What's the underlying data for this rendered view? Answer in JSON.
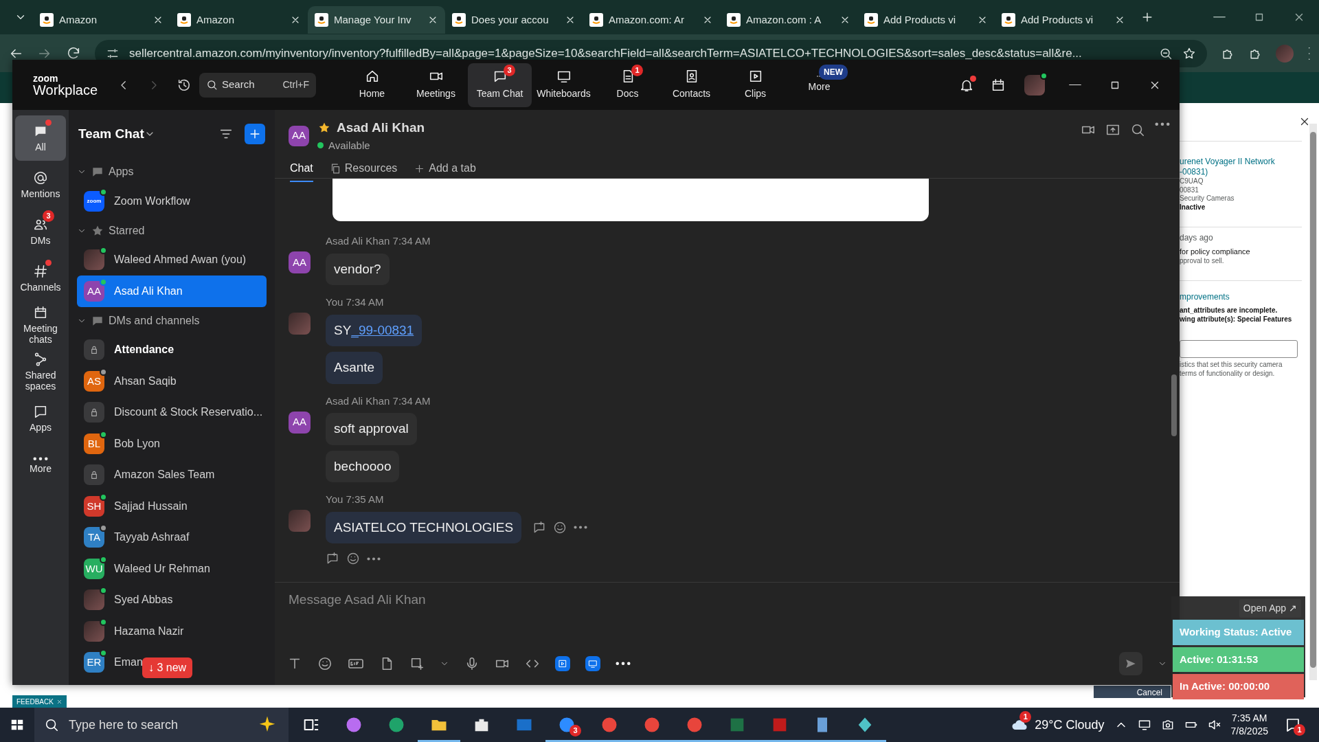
{
  "browser": {
    "tabs": [
      {
        "title": "Amazon",
        "selected": false
      },
      {
        "title": "Amazon",
        "selected": false
      },
      {
        "title": "Manage Your Inv",
        "selected": true
      },
      {
        "title": "Does your accou",
        "selected": false
      },
      {
        "title": "Amazon.com: Ar",
        "selected": false
      },
      {
        "title": "Amazon.com : A",
        "selected": false
      },
      {
        "title": "Add Products vi",
        "selected": false
      },
      {
        "title": "Add Products vi",
        "selected": false
      }
    ],
    "url": "sellercentral.amazon.com/myinventory/inventory?fulfilledBy=all&page=1&pageSize=10&searchField=all&searchTerm=ASIATELCO+TECHNOLOGIES&sort=sales_desc&status=all&re..."
  },
  "zoom": {
    "logo": {
      "top": "zoom",
      "bottom": "Workplace"
    },
    "search": {
      "placeholder": "Search",
      "shortcut": "Ctrl+F"
    },
    "nav": [
      {
        "label": "Home",
        "selected": false
      },
      {
        "label": "Meetings",
        "selected": false
      },
      {
        "label": "Team Chat",
        "selected": true,
        "badge": "3"
      },
      {
        "label": "Whiteboards",
        "selected": false
      },
      {
        "label": "Docs",
        "selected": false,
        "badge": "1"
      },
      {
        "label": "Contacts",
        "selected": false
      },
      {
        "label": "Clips",
        "selected": false
      },
      {
        "label": "More",
        "selected": false,
        "tag": "NEW"
      }
    ],
    "rail": [
      {
        "label": "All",
        "selected": true,
        "dot": true
      },
      {
        "label": "Mentions",
        "selected": false,
        "dot": false
      },
      {
        "label": "DMs",
        "selected": false,
        "dot": false,
        "badge": "3"
      },
      {
        "label": "Channels",
        "selected": false,
        "dot": true
      },
      {
        "label": "Meeting chats",
        "selected": false,
        "dot": false
      },
      {
        "label": "Shared spaces",
        "selected": false,
        "dot": false
      },
      {
        "label": "Apps",
        "selected": false,
        "dot": false
      },
      {
        "label": "More",
        "selected": false,
        "dot": false
      }
    ],
    "sidebar": {
      "title": "Team Chat",
      "new_pill": "↓ 3 new",
      "sections": [
        {
          "label": "Apps",
          "items": [
            {
              "name": "Zoom Workflow",
              "avatar": {
                "kind": "app",
                "text": "zoom"
              },
              "color": "#22c55e",
              "bold": false,
              "selected": false
            }
          ]
        },
        {
          "label": "Starred",
          "items": [
            {
              "name": "Waleed Ahmed Awan (you)",
              "avatar": {
                "kind": "photo"
              },
              "color": "#22c55e",
              "bold": false,
              "selected": false
            },
            {
              "name": "Asad Ali Khan",
              "avatar": {
                "kind": "initials",
                "text": "AA",
                "color": "#8e44ad"
              },
              "color": "#22c55e",
              "bold": false,
              "selected": true
            }
          ]
        },
        {
          "label": "DMs and channels",
          "items": [
            {
              "name": "Attendance",
              "avatar": {
                "kind": "lock"
              },
              "bold": true,
              "selected": false
            },
            {
              "name": "Ahsan Saqib",
              "avatar": {
                "kind": "initials",
                "text": "AS",
                "color": "#e0660f"
              },
              "color": "#9a9a9a",
              "bold": false,
              "selected": false
            },
            {
              "name": "Discount & Stock Reservatio...",
              "avatar": {
                "kind": "lock"
              },
              "bold": false,
              "selected": false
            },
            {
              "name": "Bob Lyon",
              "avatar": {
                "kind": "initials",
                "text": "BL",
                "color": "#e0660f"
              },
              "color": "#22c55e",
              "bold": false,
              "selected": false
            },
            {
              "name": "Amazon Sales Team",
              "avatar": {
                "kind": "lock"
              },
              "bold": false,
              "selected": false
            },
            {
              "name": "Sajjad Hussain",
              "avatar": {
                "kind": "initials",
                "text": "SH",
                "color": "#d0392b"
              },
              "color": "#22c55e",
              "bold": false,
              "selected": false
            },
            {
              "name": "Tayyab Ashraaf",
              "avatar": {
                "kind": "initials",
                "text": "TA",
                "color": "#2f80c4"
              },
              "color": "#9a9a9a",
              "bold": false,
              "selected": false
            },
            {
              "name": "Waleed Ur Rehman",
              "avatar": {
                "kind": "initials",
                "text": "WU",
                "color": "#27ae60"
              },
              "color": "#22c55e",
              "bold": false,
              "selected": false
            },
            {
              "name": "Syed Abbas",
              "avatar": {
                "kind": "photo"
              },
              "color": "#22c55e",
              "bold": false,
              "selected": false
            },
            {
              "name": "Hazama Nazir",
              "avatar": {
                "kind": "photo"
              },
              "color": "#22c55e",
              "bold": false,
              "selected": false
            },
            {
              "name": "Eman",
              "avatar": {
                "kind": "initials",
                "text": "ER",
                "color": "#2f80c4"
              },
              "color": "#22c55e",
              "bold": false,
              "selected": false
            }
          ]
        }
      ]
    },
    "chat": {
      "name": "Asad Ali Khan",
      "starred": true,
      "status": "Available",
      "avatar": {
        "text": "AA",
        "color": "#8e44ad"
      },
      "tabs": [
        {
          "label": "Chat",
          "selected": true
        },
        {
          "label": "Resources",
          "selected": false
        },
        {
          "label": "Add a tab",
          "selected": false
        }
      ],
      "attachment_preview": true,
      "messages": [
        {
          "sender": "Asad Ali Khan",
          "time": "7:34 AM",
          "mine": false,
          "avatar": {
            "kind": "initials",
            "text": "AA",
            "color": "#8e44ad"
          },
          "bubbles": [
            {
              "text": "vendor?"
            }
          ]
        },
        {
          "sender": "You",
          "time": "7:34 AM",
          "mine": true,
          "avatar": {
            "kind": "photo"
          },
          "bubbles": [
            {
              "text": "SY",
              "link": "_99-00831"
            },
            {
              "text": "Asante"
            }
          ]
        },
        {
          "sender": "Asad Ali Khan",
          "time": "7:34 AM",
          "mine": false,
          "avatar": {
            "kind": "initials",
            "text": "AA",
            "color": "#8e44ad"
          },
          "bubbles": [
            {
              "text": "soft approval"
            },
            {
              "text": "bechoooo"
            }
          ]
        },
        {
          "sender": "You",
          "time": "7:35 AM",
          "mine": true,
          "avatar": {
            "kind": "photo"
          },
          "bubbles": [
            {
              "text": "ASIATELCO TECHNOLOGIES"
            }
          ],
          "actions": true
        }
      ],
      "composer": {
        "placeholder": "Message Asad Ali Khan"
      }
    }
  },
  "amazon_panel": {
    "lines": [
      {
        "kind": "link",
        "text": "urenet Voyager II Network"
      },
      {
        "kind": "link",
        "text": "-00831)"
      },
      {
        "kind": "small",
        "text": "C9UAQ"
      },
      {
        "kind": "small",
        "text": "00831"
      },
      {
        "kind": "small",
        "text": "Security Cameras"
      },
      {
        "kind": "bold",
        "text": "Inactive"
      },
      {
        "kind": "divider"
      },
      {
        "kind": "large",
        "text": "days ago"
      },
      {
        "kind": "medium",
        "text": "for policy compliance"
      },
      {
        "kind": "small",
        "text": "pproval to sell."
      },
      {
        "kind": "divider"
      },
      {
        "kind": "heading",
        "text": "mprovements"
      },
      {
        "kind": "bold",
        "text": "ant_attributes are incomplete."
      },
      {
        "kind": "bold",
        "text": "wing attribute(s): Special Features"
      },
      {
        "kind": "input"
      },
      {
        "kind": "small",
        "text": "istics that set this security camera"
      },
      {
        "kind": "small",
        "text": "terms of functionality or design."
      }
    ],
    "cancel": "Cancel",
    "feedback": "FEEDBACK"
  },
  "tracker": {
    "open_app": "Open App ↗",
    "statuses": [
      {
        "text": "Working Status: Active",
        "color": "#6cc0d0"
      },
      {
        "text": "Active: 01:31:53",
        "color": "#55c680"
      },
      {
        "text": "In Active: 00:00:00",
        "color": "#e0625a"
      }
    ]
  },
  "taskbar": {
    "search": {
      "placeholder": "Type here to search"
    },
    "apps": [
      {
        "kind": "taskview",
        "running": false
      },
      {
        "kind": "swirl",
        "running": false
      },
      {
        "kind": "edge",
        "running": false
      },
      {
        "kind": "folder",
        "running": true
      },
      {
        "kind": "store",
        "running": false
      },
      {
        "kind": "mail",
        "running": false
      },
      {
        "kind": "zoom",
        "running": true,
        "badge": "3"
      },
      {
        "kind": "chrome",
        "running": true
      },
      {
        "kind": "chrome",
        "running": true
      },
      {
        "kind": "chrome",
        "running": true
      },
      {
        "kind": "sheet",
        "running": true
      },
      {
        "kind": "ftp",
        "running": true
      },
      {
        "kind": "calc",
        "running": true
      },
      {
        "kind": "gem",
        "running": true
      }
    ],
    "weather": {
      "text": "29°C Cloudy",
      "badge": "1"
    },
    "time": "7:35 AM",
    "date": "7/8/2025",
    "notifications": "1"
  }
}
